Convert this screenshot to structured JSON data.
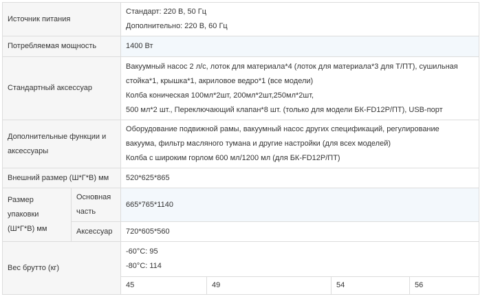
{
  "rows": {
    "power_source": {
      "label": "Источник питания",
      "lines": [
        "Стандарт: 220 В, 50 Гц",
        "Дополнительно: 220 В, 60 Гц"
      ]
    },
    "power_consumption": {
      "label": "Потребляемая мощность",
      "value": "1400 Вт"
    },
    "standard_accessories": {
      "label": "Стандартный аксессуар",
      "lines": [
        "Вакуумный насос 2 л/с, лоток для материала*4 (лоток для материала*3 для Т/ПТ), сушильная",
        "стойка*1, крышка*1, акриловое ведро*1 (все модели)",
        "Колба коническая 100мл*2шт, 200мл*2шт,250мл*2шт,",
        "500 мл*2 шт., Переключающий клапан*8 шт. (только для модели БК-FD12P/ПТ), USB-порт"
      ]
    },
    "optional": {
      "label_lines": [
        "Дополнительные функции и",
        "аксессуары"
      ],
      "lines": [
        "Оборудование подвижной рамы, вакуумный насос других спецификаций, регулирование",
        "вакуума, фильтр масляного тумана и другие настройки (для всех моделей)",
        "Колба с широким горлом 600 мл/1200 мл (для БК-FD12P/ПТ)"
      ]
    },
    "external_size": {
      "label": "Внешний размер (Ш*Г*В) мм",
      "value": "520*625*865"
    },
    "packing_size": {
      "label_lines": [
        "Размер",
        "упаковки",
        "(Ш*Г*В) мм"
      ],
      "main": {
        "label_lines": [
          "Основная",
          "часть"
        ],
        "value": "665*765*1140"
      },
      "accessory": {
        "label": "Аксессуар",
        "value": "720*605*560"
      }
    },
    "gross_weight": {
      "label": "Вес брутто (кг)",
      "temps": [
        "-60°C: 95",
        "-80°C: 114"
      ],
      "cells": [
        "45",
        "49",
        "54",
        "56"
      ]
    }
  }
}
